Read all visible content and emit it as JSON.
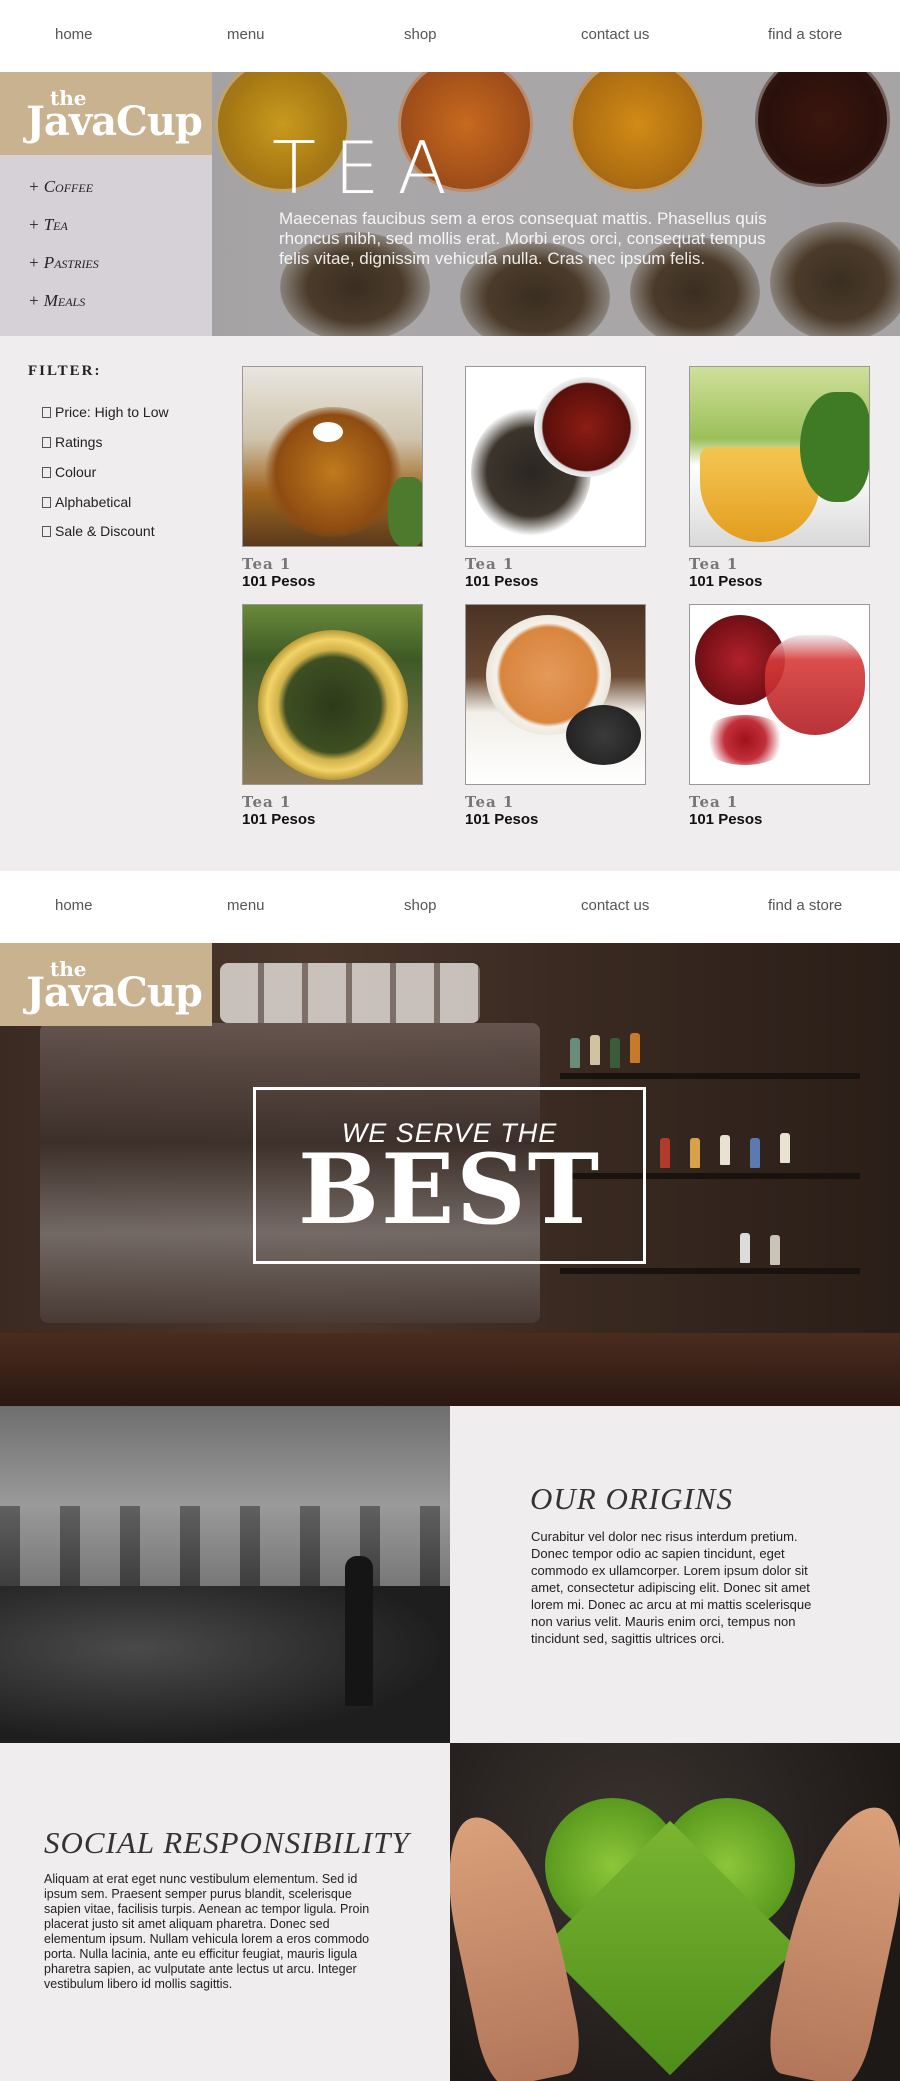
{
  "nav": {
    "links": [
      "home",
      "menu",
      "shop",
      "contact us",
      "find a store"
    ]
  },
  "brand": {
    "the": "the",
    "name": "JavaCup",
    "color": "#c9b28f"
  },
  "sidebar": {
    "items": [
      {
        "label": "+ Coffee"
      },
      {
        "label": "+ Tea"
      },
      {
        "label": "+ Pastries"
      },
      {
        "label": "+ Meals"
      }
    ]
  },
  "hero": {
    "title": "TEA",
    "text": "Maecenas faucibus sem a eros consequat mattis. Phasellus quis rhoncus nibh, sed mollis erat. Morbi eros orci, consequat tempus felis vitae, dignissim vehicula nulla. Cras nec ipsum felis."
  },
  "filter": {
    "title": "FILTER:",
    "options": [
      "Price: High to Low",
      "Ratings",
      "Colour",
      "Alphabetical",
      "Sale & Discount"
    ]
  },
  "products": [
    {
      "name": "Tea 1",
      "price": "101 Pesos",
      "icon": "tea-cup-daisy"
    },
    {
      "name": "Tea 1",
      "price": "101 Pesos",
      "icon": "tea-cup-loose-leaves"
    },
    {
      "name": "Tea 1",
      "price": "101 Pesos",
      "icon": "tea-glass-mint"
    },
    {
      "name": "Tea 1",
      "price": "101 Pesos",
      "icon": "green-tea-tin"
    },
    {
      "name": "Tea 1",
      "price": "101 Pesos",
      "icon": "tea-cup-saucer"
    },
    {
      "name": "Tea 1",
      "price": "101 Pesos",
      "icon": "pomegranate-tea"
    }
  ],
  "banner": {
    "small": "WE SERVE THE",
    "big": "BEST"
  },
  "origins": {
    "title": "OUR ORIGINS",
    "text": "Curabitur vel dolor nec risus interdum pretium. Donec tempor odio ac sapien tincidunt, eget commodo ex ullamcorper. Lorem ipsum dolor sit amet, consectetur adipiscing elit. Donec sit amet lorem mi. Donec ac arcu at mi mattis scelerisque non varius velit. Mauris enim orci, tempus non tincidunt sed, sagittis ultrices orci."
  },
  "social": {
    "title": "SOCIAL RESPONSIBILITY",
    "text": "Aliquam at erat eget nunc vestibulum elementum. Sed id ipsum sem. Praesent semper purus blandit, scelerisque sapien vitae, facilisis turpis. Aenean ac tempor ligula. Proin placerat justo sit amet aliquam pharetra. Donec sed elementum ipsum. Nullam vehicula lorem a eros commodo porta. Nulla lacinia, ante eu efficitur feugiat, mauris ligula pharetra sapien, ac vulputate ante lectus ut arcu. Integer vestibulum libero id mollis sagittis."
  }
}
